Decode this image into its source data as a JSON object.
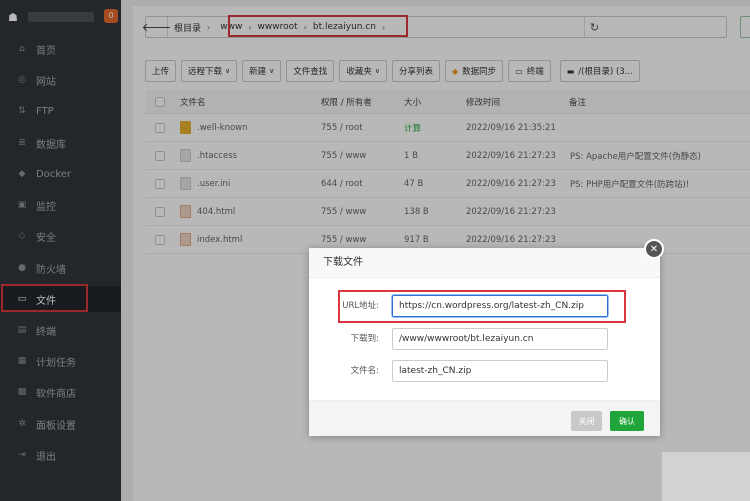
{
  "sidebar": {
    "badge": "0",
    "items": [
      {
        "label": "首页",
        "icon": "home-icon",
        "glyph": "⌂"
      },
      {
        "label": "网站",
        "icon": "globe-icon",
        "glyph": "◎"
      },
      {
        "label": "FTP",
        "icon": "ftp-icon",
        "glyph": "⇅"
      },
      {
        "label": "数据库",
        "icon": "database-icon",
        "glyph": "≣"
      },
      {
        "label": "Docker",
        "icon": "docker-icon",
        "glyph": "◆"
      },
      {
        "label": "监控",
        "icon": "monitor-icon",
        "glyph": "▣"
      },
      {
        "label": "安全",
        "icon": "shield-icon",
        "glyph": "◇"
      },
      {
        "label": "防火墙",
        "icon": "firewall-icon",
        "glyph": "●"
      },
      {
        "label": "文件",
        "icon": "folder-icon",
        "glyph": "▭"
      },
      {
        "label": "终端",
        "icon": "terminal-icon",
        "glyph": "▤"
      },
      {
        "label": "计划任务",
        "icon": "calendar-icon",
        "glyph": "▦"
      },
      {
        "label": "软件商店",
        "icon": "grid-icon",
        "glyph": "▩"
      },
      {
        "label": "面板设置",
        "icon": "gear-icon",
        "glyph": "✲"
      },
      {
        "label": "退出",
        "icon": "logout-icon",
        "glyph": "⇥"
      }
    ]
  },
  "pathbar": {
    "root": "根目录",
    "crumbs": [
      "www",
      "wwwroot",
      "bt.lezaiyun.cn"
    ]
  },
  "toolbar": {
    "upload": "上传",
    "remote_download": "远程下载",
    "new": "新建",
    "file_search": "文件查找",
    "favorites": "收藏夹",
    "share_list": "分享列表",
    "data_sync": "数据同步",
    "terminal": "终端",
    "disk": "/(根目录) (3..."
  },
  "table": {
    "headers": {
      "name": "文件名",
      "perm": "权限 / 所有者",
      "size": "大小",
      "mtime": "修改时间",
      "note": "备注"
    },
    "rows": [
      {
        "name": ".well-known",
        "kind": "folder",
        "perm": "755 / root",
        "size": "计算",
        "mtime": "2022/09/16 21:35:21",
        "note": ""
      },
      {
        "name": ".htaccess",
        "kind": "text",
        "perm": "755 / www",
        "size": "1 B",
        "mtime": "2022/09/16 21:27:23",
        "note": "PS: Apache用户配置文件(伪静态)"
      },
      {
        "name": ".user.ini",
        "kind": "text",
        "perm": "644 / root",
        "size": "47 B",
        "mtime": "2022/09/16 21:27:23",
        "note": "PS: PHP用户配置文件(防跨站)!"
      },
      {
        "name": "404.html",
        "kind": "html",
        "perm": "755 / www",
        "size": "138 B",
        "mtime": "2022/09/16 21:27:23",
        "note": ""
      },
      {
        "name": "index.html",
        "kind": "html",
        "perm": "755 / www",
        "size": "917 B",
        "mtime": "2022/09/16 21:27:23",
        "note": ""
      }
    ]
  },
  "dialog": {
    "title": "下载文件",
    "url_label": "URL地址:",
    "url_value": "https://cn.wordpress.org/latest-zh_CN.zip",
    "dest_label": "下载到:",
    "dest_value": "/www/wwwroot/bt.lezaiyun.cn",
    "name_label": "文件名:",
    "name_value": "latest-zh_CN.zip",
    "close_label": "关闭",
    "ok_label": "确认"
  },
  "colors": {
    "accent": "#20a53a",
    "highlight": "#d9363e",
    "sidebar": "#31373e"
  }
}
